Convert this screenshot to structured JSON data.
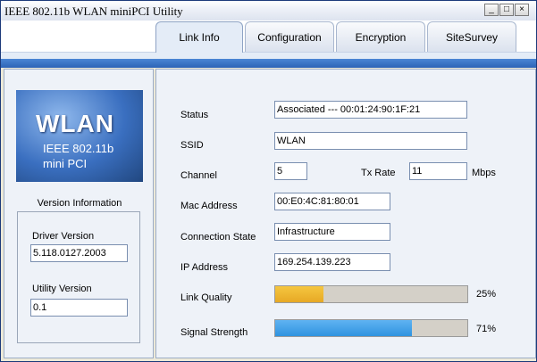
{
  "window": {
    "title": "IEEE 802.11b WLAN miniPCI Utility",
    "controls": {
      "minimize": "_",
      "maximize": "□",
      "close": "×"
    }
  },
  "tabs": [
    {
      "label": "Link Info",
      "active": true
    },
    {
      "label": "Configuration",
      "active": false
    },
    {
      "label": "Encryption",
      "active": false
    },
    {
      "label": "SiteSurvey",
      "active": false
    }
  ],
  "logo": {
    "brand": "WLAN",
    "line1": "IEEE 802.11b",
    "line2": "mini PCI"
  },
  "version_info": {
    "title": "Version Information",
    "driver_label": "Driver Version",
    "driver_value": "5.118.0127.2003",
    "utility_label": "Utility Version",
    "utility_value": "0.1"
  },
  "link_info": {
    "status_label": "Status",
    "status_value": "Associated --- 00:01:24:90:1F:21",
    "ssid_label": "SSID",
    "ssid_value": "WLAN",
    "channel_label": "Channel",
    "channel_value": "5",
    "txrate_label": "Tx Rate",
    "txrate_value": "11",
    "txrate_unit": "Mbps",
    "mac_label": "Mac Address",
    "mac_value": "00:E0:4C:81:80:01",
    "conn_label": "Connection State",
    "conn_value": "Infrastructure",
    "ip_label": "IP Address",
    "ip_value": "169.254.139.223",
    "quality_label": "Link Quality",
    "quality_percent": 25,
    "quality_text": "25%",
    "signal_label": "Signal Strength",
    "signal_percent": 71,
    "signal_text": "71%"
  },
  "colors": {
    "quality_fill": "#f5c640",
    "signal_fill": "#2f93e0",
    "header_blue": "#2d64b6"
  }
}
